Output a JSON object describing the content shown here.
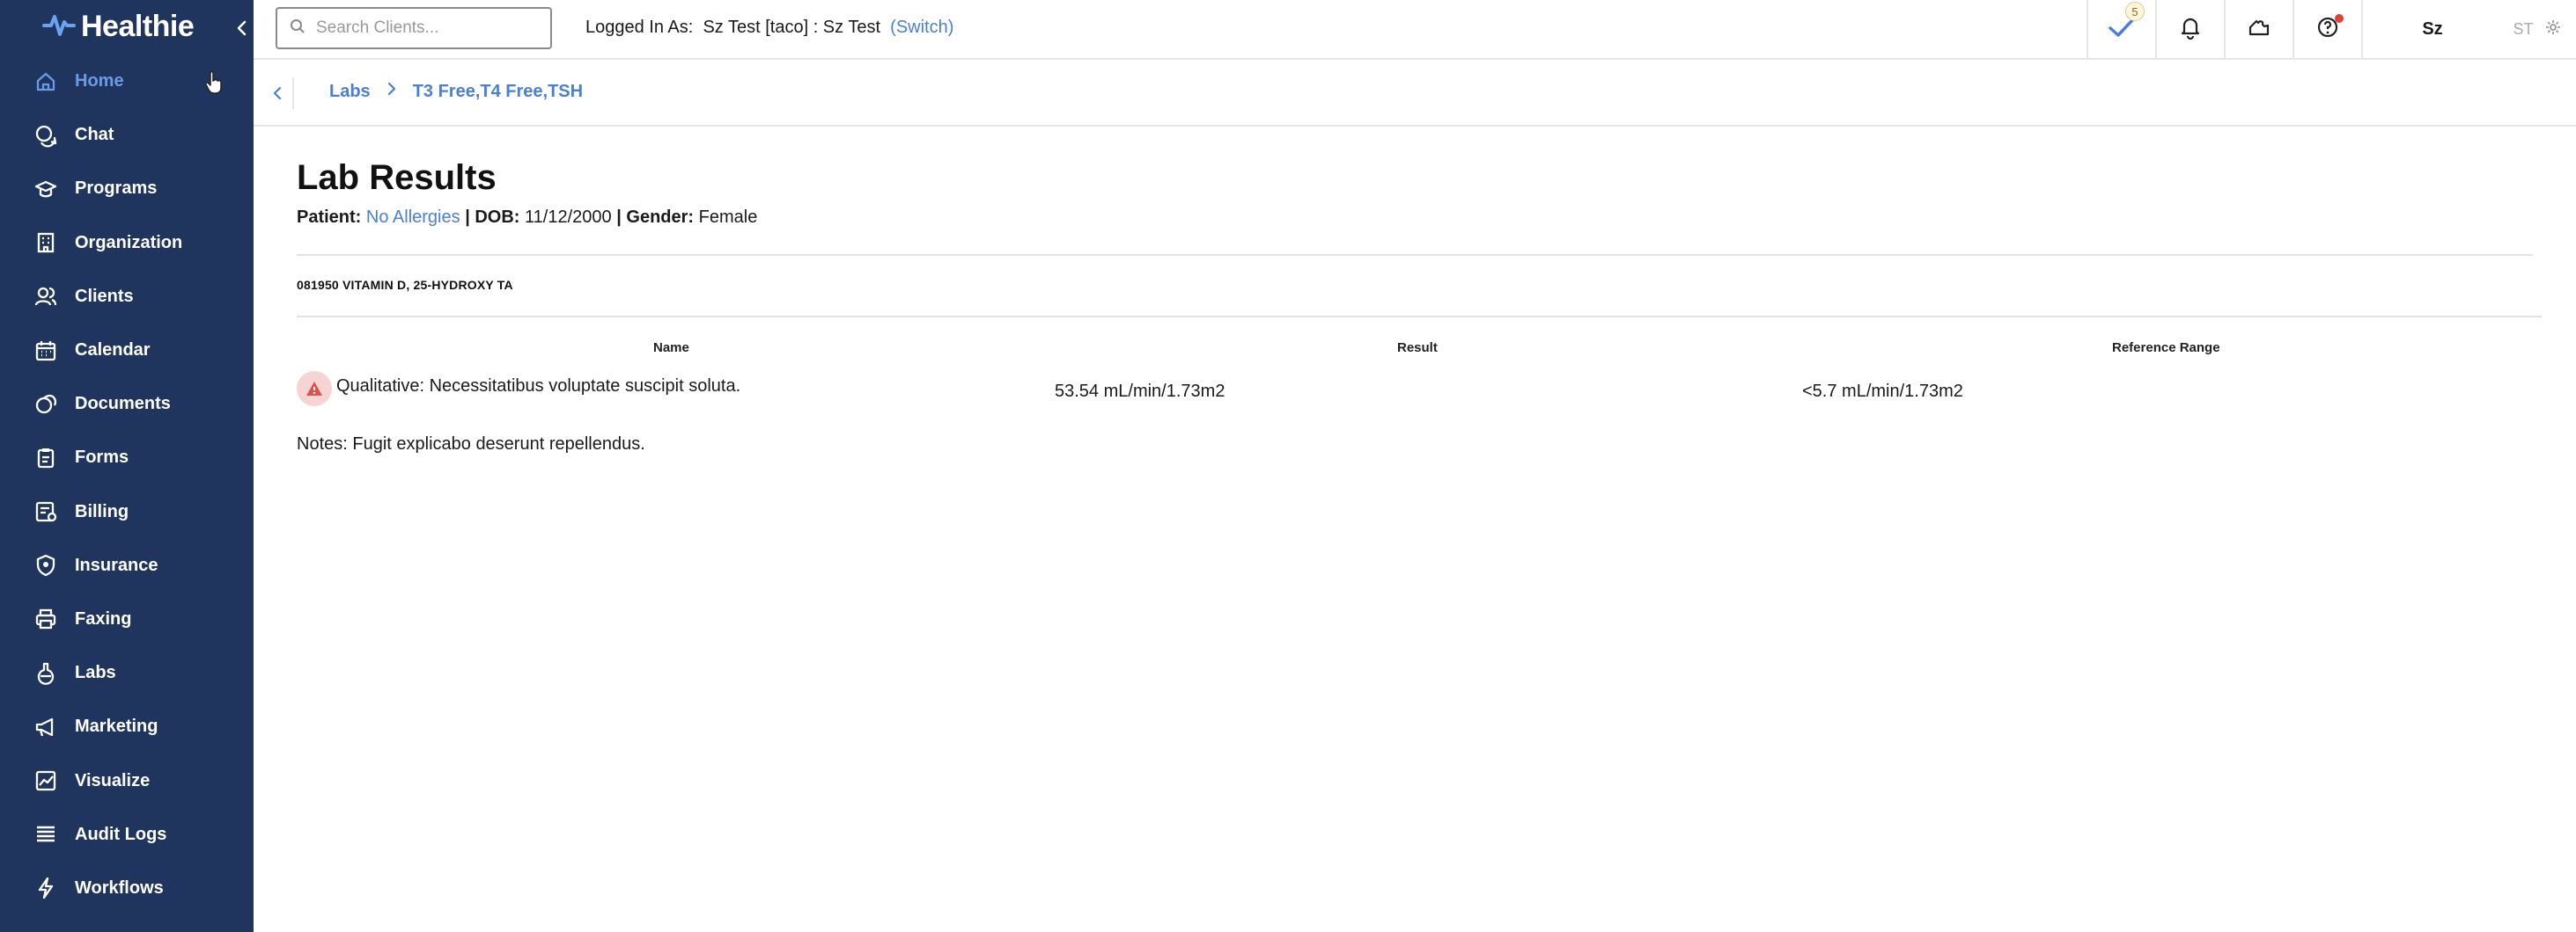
{
  "brand": {
    "name": "Healthie"
  },
  "sidebar": {
    "items": [
      {
        "label": "Home",
        "icon": "home-icon",
        "active": true
      },
      {
        "label": "Chat",
        "icon": "chat-icon"
      },
      {
        "label": "Programs",
        "icon": "graduation-cap-icon"
      },
      {
        "label": "Organization",
        "icon": "building-icon"
      },
      {
        "label": "Clients",
        "icon": "users-icon"
      },
      {
        "label": "Calendar",
        "icon": "calendar-icon"
      },
      {
        "label": "Documents",
        "icon": "documents-icon"
      },
      {
        "label": "Forms",
        "icon": "clipboard-icon"
      },
      {
        "label": "Billing",
        "icon": "billing-icon"
      },
      {
        "label": "Insurance",
        "icon": "shield-icon"
      },
      {
        "label": "Faxing",
        "icon": "printer-icon"
      },
      {
        "label": "Labs",
        "icon": "flask-icon"
      },
      {
        "label": "Marketing",
        "icon": "megaphone-icon"
      },
      {
        "label": "Visualize",
        "icon": "chart-icon"
      },
      {
        "label": "Audit Logs",
        "icon": "list-icon"
      },
      {
        "label": "Workflows",
        "icon": "bolt-icon"
      }
    ]
  },
  "topbar": {
    "search_placeholder": "Search Clients...",
    "logged_in_label": "Logged In As:",
    "logged_in_user": "Sz Test [taco] : Sz Test",
    "switch_label": "(Switch)",
    "tasks_count": "5",
    "user_initials": "Sz",
    "alt_initials": "ST"
  },
  "breadcrumb": {
    "items": [
      "Labs",
      "T3 Free,T4 Free,TSH"
    ]
  },
  "page": {
    "title": "Lab Results",
    "patient_label": "Patient:",
    "patient_value": "No Allergies",
    "dob_label": "DOB:",
    "dob_value": "11/12/2000",
    "gender_label": "Gender:",
    "gender_value": "Female",
    "separator": "|",
    "panel_code": "081950 VITAMIN D, 25-HYDROXY TA"
  },
  "table": {
    "headers": [
      "Name",
      "Result",
      "Reference Range"
    ],
    "rows": [
      {
        "name": "Qualitative: Necessitatibus voluptate suscipit soluta.",
        "result": "53.54 mL/min/1.73m2",
        "reference": "<5.7 mL/min/1.73m2",
        "flag": "warning"
      }
    ]
  },
  "notes": "Notes: Fugit explicabo deserunt repellendus.",
  "colors": {
    "sidebar_bg": "#1f355e",
    "accent": "#4a7fd6",
    "active_nav": "#6b9be6",
    "warning_bg": "#f6d4d3",
    "warning_icon": "#d9534f"
  }
}
